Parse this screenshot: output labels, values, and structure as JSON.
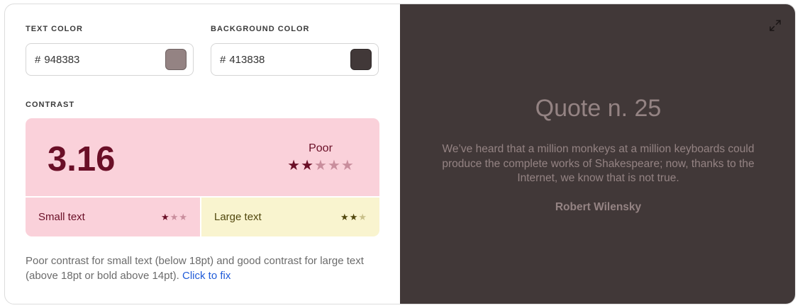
{
  "text_color": {
    "label": "TEXT COLOR",
    "hash": "#",
    "value": "948383",
    "hex": "#948383"
  },
  "background_color": {
    "label": "BACKGROUND COLOR",
    "hash": "#",
    "value": "413838",
    "hex": "#413838"
  },
  "contrast": {
    "label": "CONTRAST",
    "ratio": "3.16",
    "rating": "Poor",
    "stars_filled": 2,
    "stars_total": 5,
    "small_text": {
      "label": "Small text",
      "stars_filled": 1,
      "stars_total": 3
    },
    "large_text": {
      "label": "Large text",
      "stars_filled": 2,
      "stars_total": 3
    },
    "description": "Poor contrast for small text (below 18pt) and good contrast for large text (above 18pt or bold above 14pt).",
    "fix_link": "Click to fix"
  },
  "colors": {
    "poor_bg": "#fad1da",
    "poor_fg": "#6a0f27",
    "poor_star_empty": "#c98e9d",
    "good_bg": "#f9f4cf",
    "good_fg": "#51470d",
    "good_star_empty": "#c9c08a"
  },
  "preview": {
    "expand_icon": "expand-icon",
    "title": "Quote n. 25",
    "quote": "We’ve heard that a million monkeys at a million keyboards could produce the complete works of Shakespeare; now, thanks to the Internet, we know that is not true.",
    "author": "Robert Wilensky"
  }
}
